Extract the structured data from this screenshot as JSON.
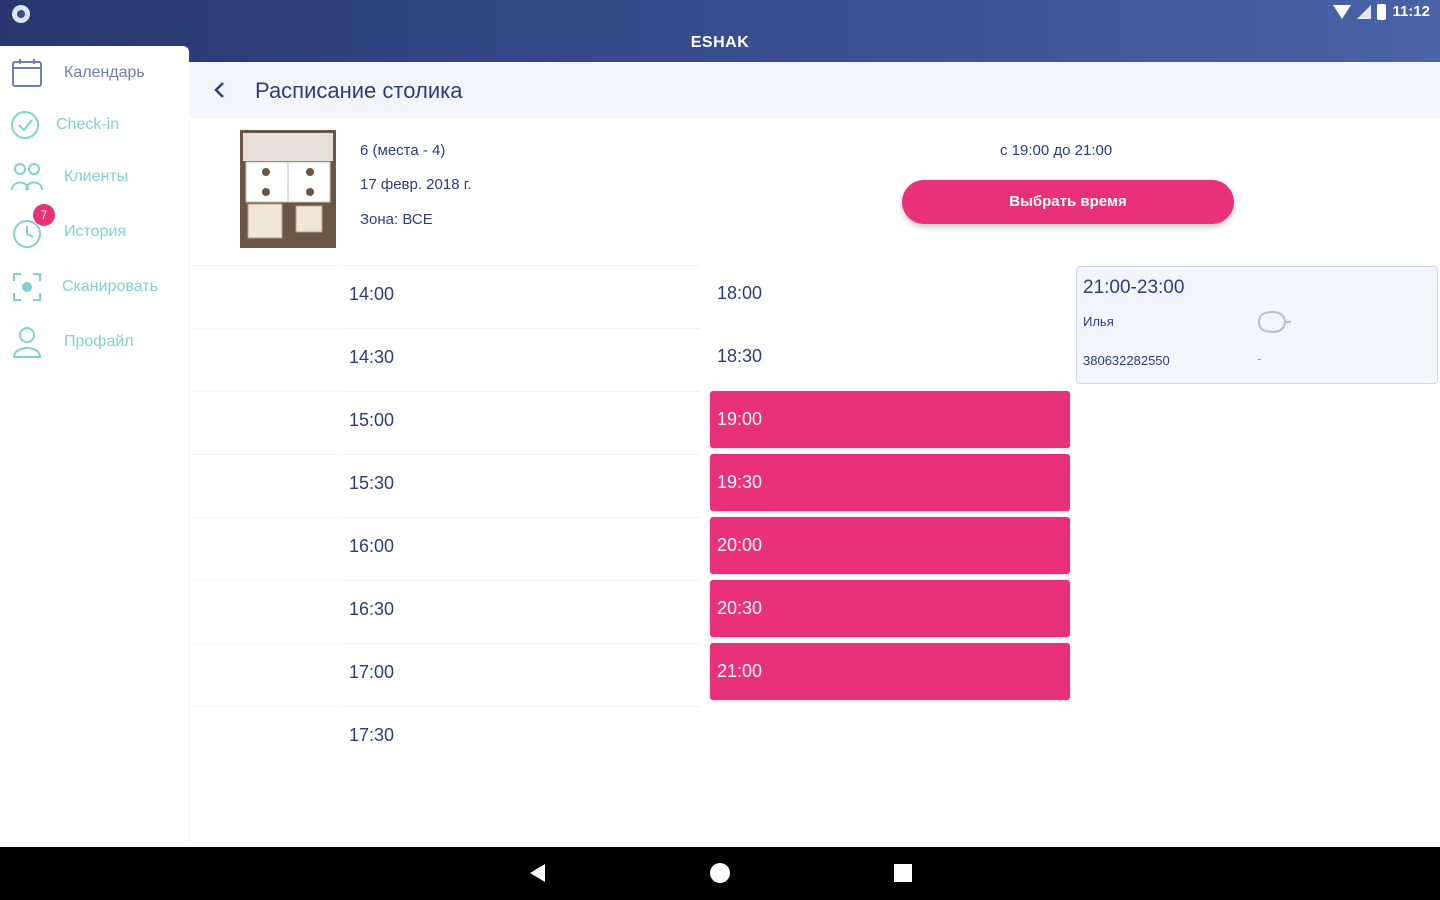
{
  "app": {
    "title": "ESHAK",
    "clock": "11:12"
  },
  "sidebar": {
    "items": [
      {
        "label": "Календарь",
        "icon": "calendar-icon"
      },
      {
        "label": "Check-in",
        "icon": "check-circle-icon"
      },
      {
        "label": "Клиенты",
        "icon": "clients-icon"
      },
      {
        "label": "История",
        "icon": "history-icon",
        "badge": "7"
      },
      {
        "label": "Сканировать",
        "icon": "scan-icon"
      },
      {
        "label": "Профайл",
        "icon": "profile-icon"
      }
    ]
  },
  "header": {
    "title": "Расписание столика"
  },
  "table_info": {
    "seats": "6 (места - 4)",
    "date": "17 февр. 2018 г.",
    "zone": "Зона: ВСЕ",
    "range": "с 19:00 до 21:00",
    "choose_label": "Выбрать время"
  },
  "schedule": {
    "col_a": [
      "14:00",
      "14:30",
      "15:00",
      "15:30",
      "16:00",
      "16:30",
      "17:00",
      "17:30"
    ],
    "col_b": [
      "18:00",
      "18:30",
      "19:00",
      "19:30",
      "20:00",
      "20:30",
      "21:00"
    ],
    "col_b_selected_from": 2
  },
  "booking": {
    "time": "21:00-23:00",
    "name": "Илья",
    "phone": "380632282550",
    "dash": "-"
  },
  "colors": {
    "accent": "#e8317a",
    "primary": "#2a3f7a",
    "nav_inactive": "#7fd3cc",
    "header_bg": "#f2f6fc"
  }
}
